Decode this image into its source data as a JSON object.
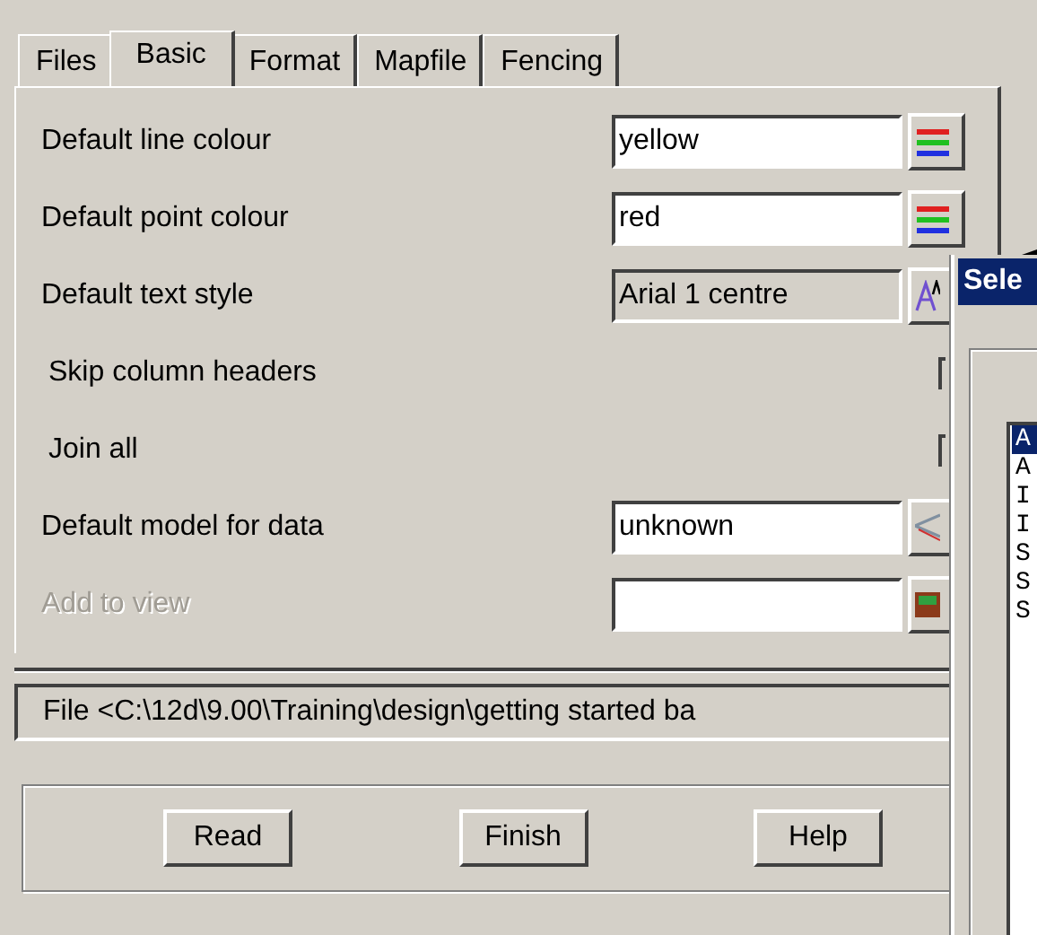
{
  "tabs": [
    {
      "label": "Files",
      "selected": false
    },
    {
      "label": "Basic",
      "selected": true
    },
    {
      "label": "Format",
      "selected": false
    },
    {
      "label": "Mapfile",
      "selected": false
    },
    {
      "label": "Fencing",
      "selected": false
    }
  ],
  "fields": [
    {
      "kind": "colour",
      "label": "Default line colour",
      "value": "yellow",
      "disabled": false
    },
    {
      "kind": "textstyle_colour",
      "label": "Default point colour",
      "value": "red",
      "disabled": false
    },
    {
      "kind": "textstyle",
      "label": "Default text style",
      "value": "Arial 1 centre",
      "disabled": false
    },
    {
      "kind": "checkbox",
      "label": "Skip column headers",
      "disabled": false
    },
    {
      "kind": "checkbox",
      "label": "Join all",
      "disabled": false
    },
    {
      "kind": "model",
      "label": "Default model for data",
      "value": "unknown",
      "disabled": false
    },
    {
      "kind": "view",
      "label": "Add to view",
      "disabled": true
    }
  ],
  "status": "File <C:\\12d\\9.00\\Training\\design\\getting started ba",
  "buttons": [
    "Read",
    "Finish",
    "Help"
  ],
  "dialog": {
    "title": "Sele",
    "items": [
      {
        "label": "A",
        "selected": true
      },
      {
        "label": "A",
        "selected": false
      },
      {
        "label": "I",
        "selected": false
      },
      {
        "label": "I",
        "selected": false
      },
      {
        "label": "S",
        "selected": false
      },
      {
        "label": "S",
        "selected": false
      },
      {
        "label": "S",
        "selected": false
      }
    ]
  }
}
